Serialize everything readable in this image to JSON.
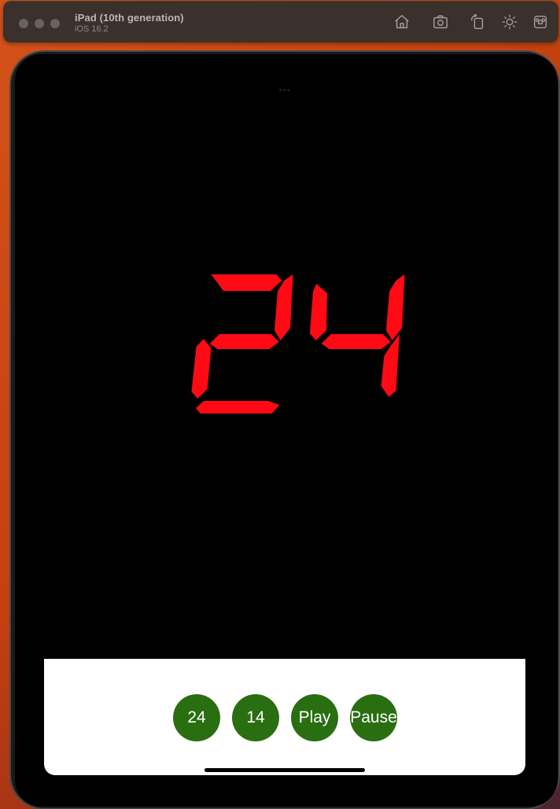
{
  "window": {
    "device_name": "iPad (10th generation)",
    "os_version": "iOS 16.2",
    "toolbar_icons": [
      "home-icon",
      "screenshot-icon",
      "rotate-icon",
      "appearance-icon",
      "keyboard-icon"
    ]
  },
  "shot_clock": {
    "display_value": "24",
    "digit_color": "#ff0a14"
  },
  "controls": {
    "buttons": [
      {
        "label": "24"
      },
      {
        "label": "14"
      },
      {
        "label": "Play"
      },
      {
        "label": "Pause"
      }
    ],
    "button_color": "#2a6e12"
  }
}
